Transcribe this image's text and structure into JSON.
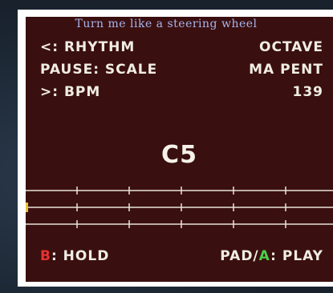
{
  "title": "Turn me like a steering wheel",
  "rows": [
    {
      "left": "<: RHYTHM",
      "right": "OCTAVE"
    },
    {
      "left": "PAUSE: SCALE",
      "right": "MA PENT"
    },
    {
      "left": ">: BPM",
      "right": "139"
    }
  ],
  "note": "C5",
  "footer": {
    "hold_key": "B",
    "hold_label": ": HOLD",
    "pad_label": "PAD/",
    "play_key": "A",
    "play_label": ": PLAY"
  },
  "colors": {
    "screen_bg": "#3a0f0f",
    "title": "#a8b4ec",
    "key_red": "#e8322e",
    "key_green": "#4bd04b",
    "marker": "#e6c23a"
  }
}
